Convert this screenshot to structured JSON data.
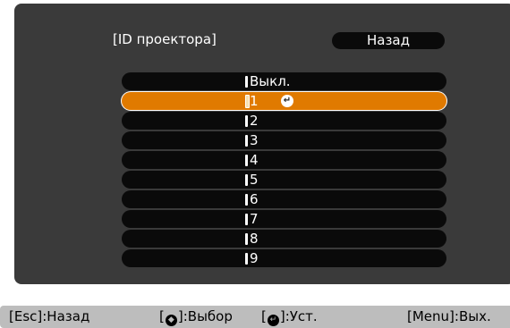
{
  "dialog": {
    "title": "[ID проектора]",
    "back_label": "Назад"
  },
  "options": [
    {
      "label": "Выкл.",
      "selected": false
    },
    {
      "label": "1",
      "selected": true
    },
    {
      "label": "2",
      "selected": false
    },
    {
      "label": "3",
      "selected": false
    },
    {
      "label": "4",
      "selected": false
    },
    {
      "label": "5",
      "selected": false
    },
    {
      "label": "6",
      "selected": false
    },
    {
      "label": "7",
      "selected": false
    },
    {
      "label": "8",
      "selected": false
    },
    {
      "label": "9",
      "selected": false
    }
  ],
  "help_bar": {
    "esc_key": "[Esc]",
    "esc_action": ":Назад",
    "select_action": ":Выбор",
    "enter_action": ":Уст.",
    "menu_key": "[Menu]",
    "menu_action": ":Вых."
  },
  "colors": {
    "panel": "#3a3a3a",
    "row": "#0a0a0a",
    "selected": "#e07a00",
    "helpbar": "#bdbdbd"
  },
  "icons": {
    "enter": "enter-icon",
    "up_down": "up-down-icon"
  }
}
